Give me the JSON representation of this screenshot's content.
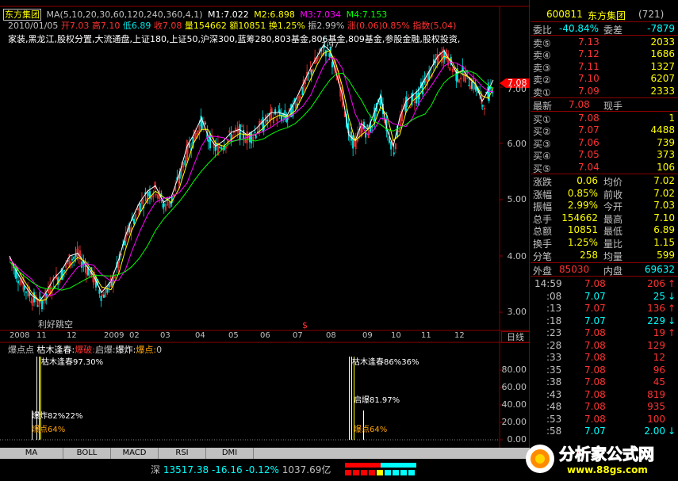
{
  "header": {
    "stock_name": "东方集团",
    "ma_params": "MA(5,10,20,30,60,120,240,360,4,1)",
    "m1": "M1:7.022",
    "m2": "M2:6.898",
    "m3": "M3:7.034",
    "m4": "M4:7.153",
    "m1_color": "#ffffff",
    "m2_color": "#ffff00",
    "m3_color": "#ff00ff",
    "m4_color": "#00ff00",
    "date": "2010/01/05",
    "open": "开7.03",
    "high": "高7.10",
    "low": "低6.89",
    "close": "收7.08",
    "volume": "量154662",
    "amount": "额10851",
    "turnover": "换1.25%",
    "amplitude": "振2.99%",
    "change": "涨(0.06)0.85%",
    "index": "指数(5.04)",
    "concepts": "家装,黑龙江,股权分置,大流通盘,上证180,上证50,沪深300,蓝筹280,803基金,806基金,809基金,参股金融,股权投资,"
  },
  "chart": {
    "price_ticks": [
      "7.00",
      "6.00",
      "5.00",
      "4.00",
      "3.00"
    ],
    "current_price_tag": "7.08",
    "high_marker": "7.97",
    "annotation": "利好跳空",
    "date_labels": [
      "2008",
      "11",
      "12",
      "2009",
      "02",
      "03",
      "04",
      "05",
      "06",
      "07",
      "08",
      "09",
      "10",
      "11",
      "12"
    ],
    "period_label": "日线",
    "dollar_marker": "$"
  },
  "indicator": {
    "name": "爆点点",
    "param1": "枯木逢春:",
    "param2": "爆破:",
    "param3": "启爆:",
    "param4": "爆炸:",
    "param5": "爆点:",
    "param5_value": "0",
    "axis_ticks": [
      "80.00",
      "60.00",
      "40.00",
      "20.00",
      "0.00"
    ],
    "labels_left": [
      "枯木逢春97.30%",
      "爆炸82%22%",
      "爆点64%"
    ],
    "labels_right": [
      "枯木逢春86%36%",
      "启爆81.97%",
      "爆点64%"
    ]
  },
  "tabs": [
    "MA",
    "BOLL",
    "MACD",
    "RSI",
    "DMI"
  ],
  "status": {
    "market": "深",
    "index_value": "13517.38",
    "change": "-16.16",
    "pct": "-0.12%",
    "amount": "1037.69亿"
  },
  "watermark": {
    "title": "分析家公式网",
    "url": "www.88gs.com"
  },
  "quote": {
    "code": "600811",
    "name": "东方集团",
    "rank": "(721)",
    "weibi_label": "委比",
    "weibi_value": "-40.84%",
    "weicha_label": "委差",
    "weicha_value": "-7879",
    "asks": [
      {
        "label": "卖⑤",
        "price": "7.13",
        "vol": "2033"
      },
      {
        "label": "卖④",
        "price": "7.12",
        "vol": "1686"
      },
      {
        "label": "卖③",
        "price": "7.11",
        "vol": "1327"
      },
      {
        "label": "卖②",
        "price": "7.10",
        "vol": "6207"
      },
      {
        "label": "卖①",
        "price": "7.09",
        "vol": "2333"
      }
    ],
    "latest_label": "最新",
    "latest_price": "7.08",
    "latest_right": "现手",
    "bids": [
      {
        "label": "买①",
        "price": "7.08",
        "vol": "1"
      },
      {
        "label": "买②",
        "price": "7.07",
        "vol": "4488"
      },
      {
        "label": "买③",
        "price": "7.06",
        "vol": "739"
      },
      {
        "label": "买④",
        "price": "7.05",
        "vol": "373"
      },
      {
        "label": "买⑤",
        "price": "7.04",
        "vol": "106"
      }
    ],
    "stats": [
      {
        "l1": "涨跌",
        "v1": "0.06",
        "l2": "均价",
        "v2": "7.02"
      },
      {
        "l1": "涨幅",
        "v1": "0.85%",
        "l2": "前收",
        "v2": "7.02"
      },
      {
        "l1": "振幅",
        "v1": "2.99%",
        "l2": "今开",
        "v2": "7.03"
      },
      {
        "l1": "总手",
        "v1": "154662",
        "l2": "最高",
        "v2": "7.10"
      },
      {
        "l1": "总额",
        "v1": "10851",
        "l2": "最低",
        "v2": "6.89"
      },
      {
        "l1": "换手",
        "v1": "1.25%",
        "l2": "量比",
        "v2": "1.15"
      },
      {
        "l1": "分笔",
        "v1": "258",
        "l2": "均量",
        "v2": "599"
      }
    ],
    "outer_label": "外盘",
    "outer_value": "85030",
    "inner_label": "内盘",
    "inner_value": "69632",
    "ticks": [
      {
        "time": "14:59",
        "price": "7.08",
        "vol": "206",
        "dir": "up"
      },
      {
        "time": ":08",
        "price": "7.07",
        "vol": "25",
        "dir": "down"
      },
      {
        "time": ":13",
        "price": "7.07",
        "vol": "136",
        "dir": "up"
      },
      {
        "time": ":18",
        "price": "7.07",
        "vol": "229",
        "dir": "down"
      },
      {
        "time": ":23",
        "price": "7.08",
        "vol": "19",
        "dir": "up"
      },
      {
        "time": ":28",
        "price": "7.08",
        "vol": "129",
        "dir": ""
      },
      {
        "time": ":33",
        "price": "7.08",
        "vol": "12",
        "dir": ""
      },
      {
        "time": ":35",
        "price": "7.08",
        "vol": "96",
        "dir": ""
      },
      {
        "time": ":38",
        "price": "7.08",
        "vol": "45",
        "dir": ""
      },
      {
        "time": ":43",
        "price": "7.08",
        "vol": "819",
        "dir": ""
      },
      {
        "time": ":48",
        "price": "7.08",
        "vol": "935",
        "dir": ""
      },
      {
        "time": ":53",
        "price": "7.08",
        "vol": "100",
        "dir": ""
      },
      {
        "time": ":58",
        "price": "7.07",
        "vol": "2.00",
        "dir": "down"
      }
    ]
  },
  "colors": {
    "up": "#ff3232",
    "down": "#00e5e5",
    "cyan": "#00ffff",
    "yellow": "#ffff00",
    "gold": "#ffa500",
    "label": "#ff0000",
    "border": "#8b0000"
  }
}
